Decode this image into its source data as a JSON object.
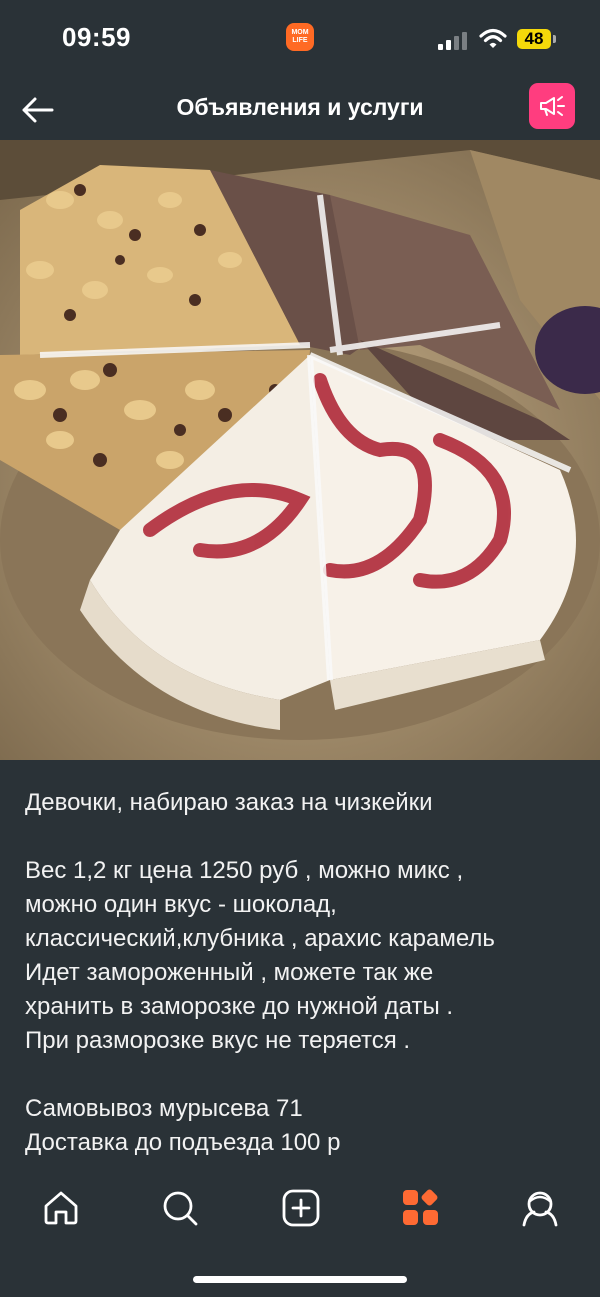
{
  "status_bar": {
    "time": "09:59",
    "app_logo_text": "MOM LIFE",
    "battery": "48"
  },
  "header": {
    "title": "Объявления и услуги",
    "back_icon": "arrow-left-icon",
    "promo_icon": "megaphone-icon",
    "promo_color": "#ff3d7f"
  },
  "photo": {
    "subject": "cheesecake-slices-in-box"
  },
  "post": {
    "text": "Девочки, набираю заказ на чизкейки\n\nВес 1,2 кг цена 1250 руб , можно микс ,\nможно один вкус - шоколад,\nклассический,клубника , арахис карамель\nИдет замороженный , можете так же\nхранить в заморозке до нужной даты .\nПри разморозке вкус не теряется .\n\nСамовывоз мурысева 71\nДоставка до подъезда 100 р"
  },
  "tab_bar": {
    "tabs": [
      {
        "icon": "home-icon",
        "active": false
      },
      {
        "icon": "search-icon",
        "active": false
      },
      {
        "icon": "add-post-icon",
        "active": false
      },
      {
        "icon": "services-grid-icon",
        "active": true
      },
      {
        "icon": "profile-icon",
        "active": false
      }
    ],
    "active_color": "#ff6a33"
  },
  "colors": {
    "background": "#2a3237",
    "accent": "#ff6a33"
  }
}
